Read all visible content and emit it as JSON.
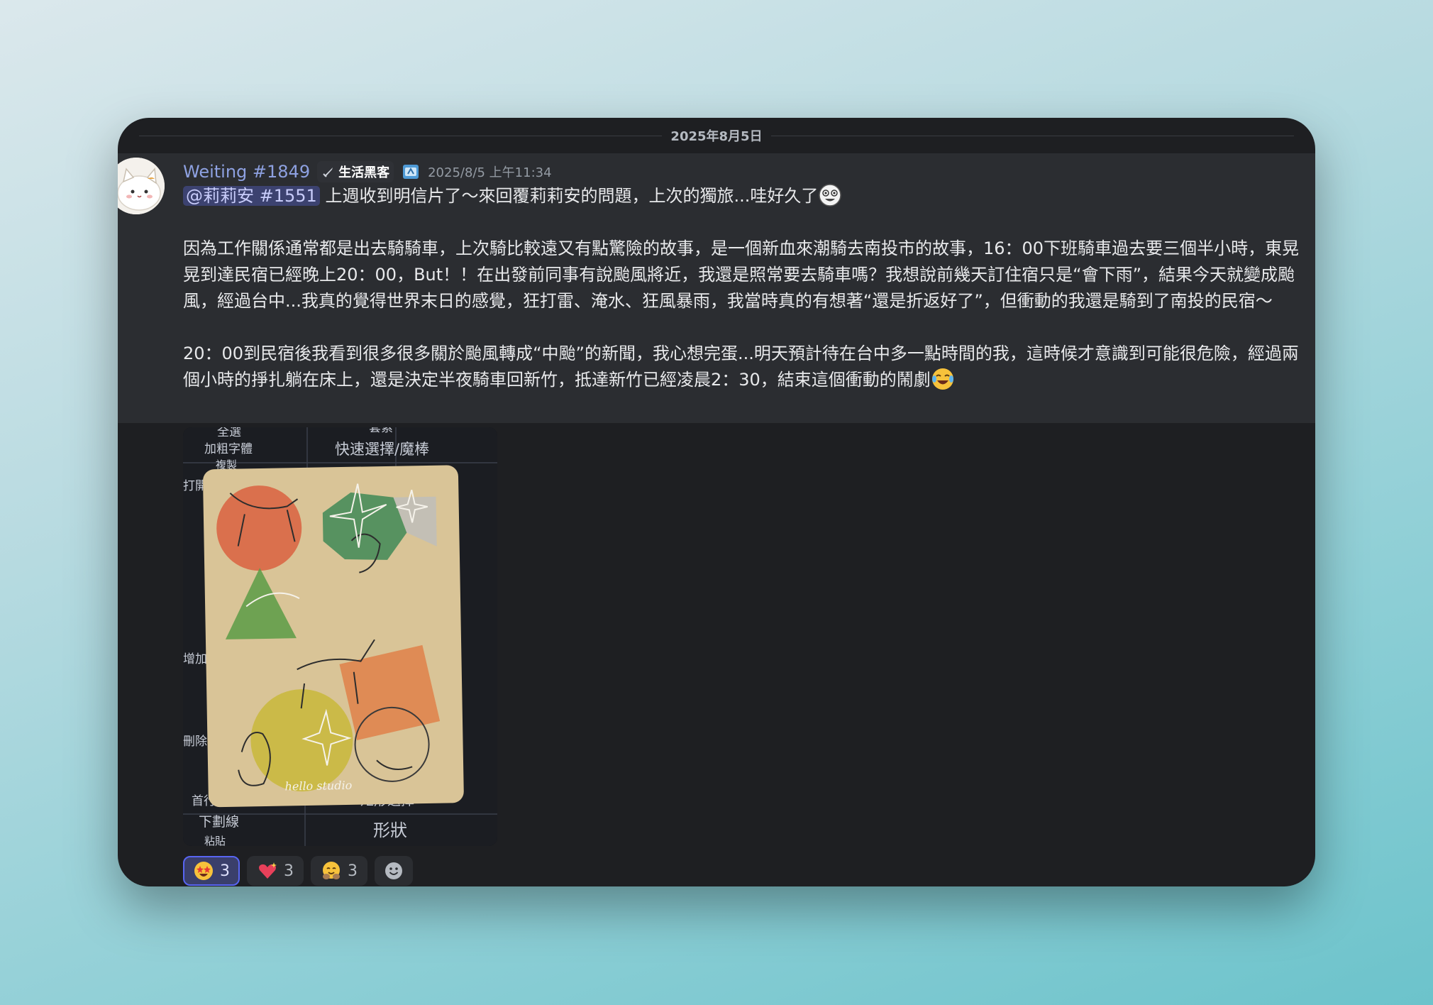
{
  "date_divider": "2025年8月5日",
  "message": {
    "author": "Weiting #1849",
    "role_tag": "生活黑客",
    "timestamp": "2025/8/5 上午11:34",
    "mention": "@莉莉安 #1551",
    "first_line": "上週收到明信片了～來回覆莉莉安的問題，上次的獨旅...哇好久了",
    "paragraph1": "因為工作關係通常都是出去騎騎車，上次騎比較遠又有點驚險的故事，是一個新血來潮騎去南投市的故事，16：00下班騎車過去要三個半小時，東晃晃到達民宿已經晚上20：00，But！！在出發前同事有說颱風將近，我還是照常要去騎車嗎？我想說前幾天訂住宿只是“會下雨”，結果今天就變成颱風，經過台中...我真的覺得世界末日的感覺，狂打雷、淹水、狂風暴雨，我當時真的有想著“還是折返好了”，但衝動的我還是騎到了南投的民宿～",
    "paragraph2": "20：00到民宿後我看到很多很多關於颱風轉成“中颱”的新聞，我心想完蛋...明天預計待在台中多一點時間的我，這時候才意識到可能很危險，經過兩個小時的掙扎躺在床上，還是決定半夜騎車回新竹，抵達新竹已經凌晨2：30，結束這個衝動的鬧劇"
  },
  "attachment_text": {
    "top_left_1": "全選",
    "top_left_2": "加粗字體",
    "top_left_3": "複製",
    "top_left_4": "打開",
    "top_mid": "套索",
    "top_mid_2": "快速選擇/魔棒",
    "bottom_left_1": "首行縮進",
    "bottom_left_2": "下劃線",
    "bottom_left_3": "粘貼",
    "bottom_mid_1": "矩形選擇",
    "bottom_mid_2": "形狀",
    "side_1": "增加",
    "side_2": "刪除",
    "card_script": "hello studio"
  },
  "reactions": [
    {
      "emoji": "star-struck-emoji",
      "count": "3",
      "active": true
    },
    {
      "emoji": "sparkling-heart-emoji",
      "count": "3",
      "active": false
    },
    {
      "emoji": "hugging-face-emoji",
      "count": "3",
      "active": false
    }
  ],
  "colors": {
    "card_bg": "#1e1f22",
    "message_hover_bg": "#2b2d31",
    "username": "#8ea1e1",
    "mention_bg": "#3c4270",
    "active_reaction_border": "#5865f2"
  }
}
